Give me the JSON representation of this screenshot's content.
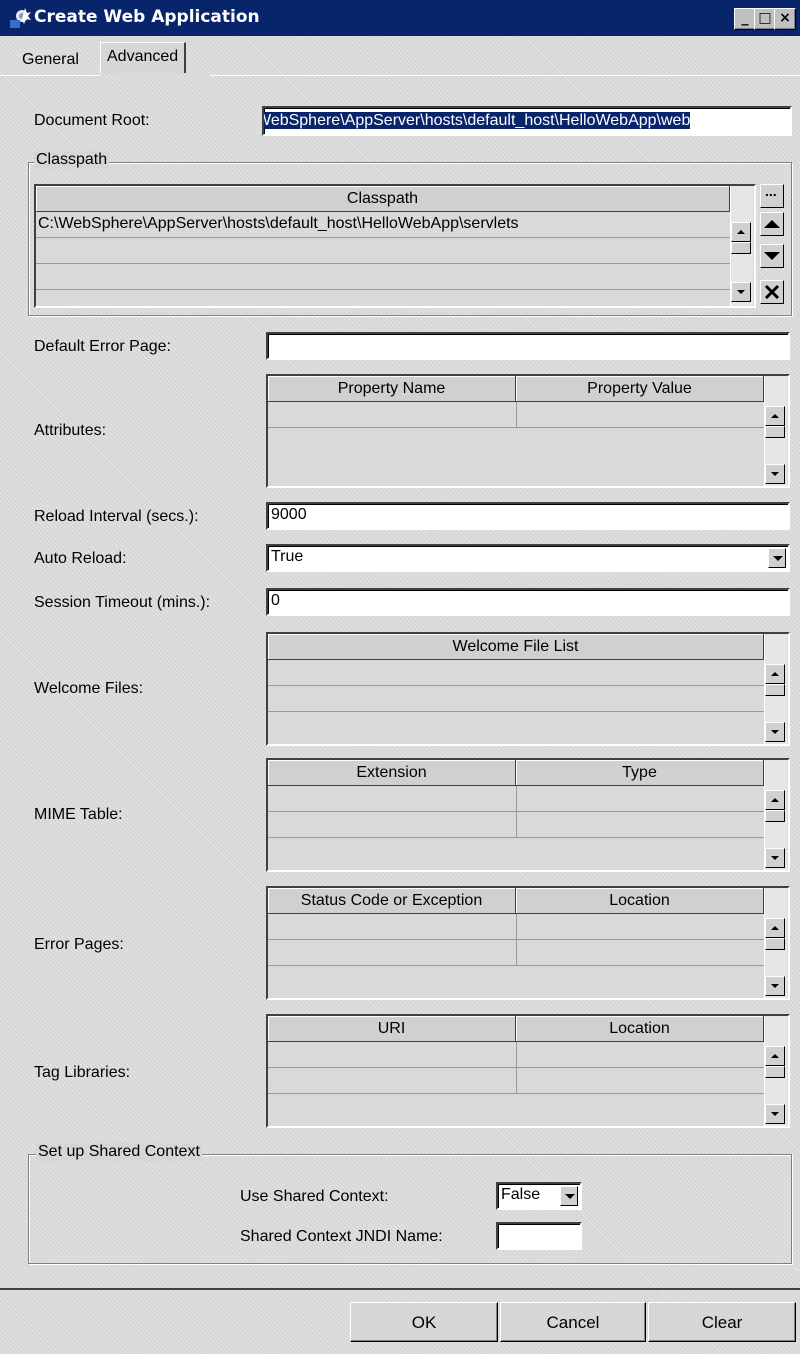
{
  "window": {
    "title": "Create Web Application",
    "controls": [
      "_",
      "□",
      "×"
    ]
  },
  "tabs": [
    {
      "label": "General"
    },
    {
      "label": "Advanced"
    }
  ],
  "document_root": {
    "label": "Document Root:",
    "value": "WebSphere\\AppServer\\hosts\\default_host\\HelloWebApp\\web"
  },
  "classpath": {
    "group_title": "Classpath",
    "header": "Classpath",
    "rows": [
      "C:\\WebSphere\\AppServer\\hosts\\default_host\\HelloWebApp\\servlets",
      "",
      ""
    ],
    "browse_label": "..."
  },
  "default_error_page": {
    "label": "Default Error Page:",
    "value": ""
  },
  "attributes": {
    "label": "Attributes:",
    "headers": [
      "Property Name",
      "Property Value"
    ]
  },
  "reload_interval": {
    "label": "Reload Interval (secs.):",
    "value": "9000"
  },
  "auto_reload": {
    "label": "Auto Reload:",
    "value": "True"
  },
  "session_timeout": {
    "label": "Session Timeout (mins.):",
    "value": "0"
  },
  "welcome_files": {
    "label": "Welcome Files:",
    "header": "Welcome File List"
  },
  "mime_table": {
    "label": "MIME Table:",
    "headers": [
      "Extension",
      "Type"
    ]
  },
  "error_pages": {
    "label": "Error Pages:",
    "headers": [
      "Status Code or Exception",
      "Location"
    ]
  },
  "tag_libraries": {
    "label": "Tag Libraries:",
    "headers": [
      "URI",
      "Location"
    ]
  },
  "shared_context": {
    "group_title": "Set up Shared Context",
    "use_label": "Use Shared Context:",
    "use_value": "False",
    "jndi_label": "Shared Context JNDI Name:",
    "jndi_value": ""
  },
  "buttons": {
    "ok": "OK",
    "cancel": "Cancel",
    "clear": "Clear"
  }
}
